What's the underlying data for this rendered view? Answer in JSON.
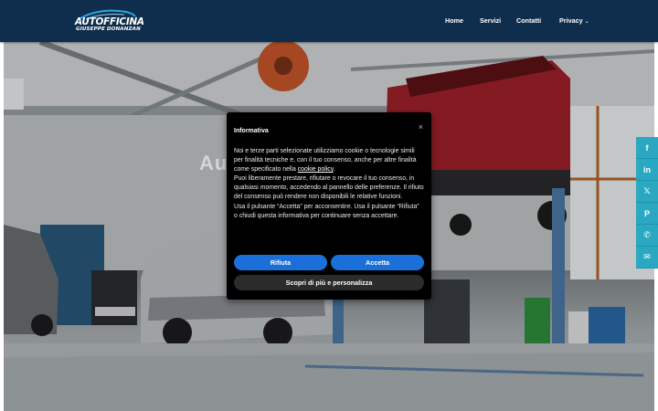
{
  "brand": {
    "name": "AUTOFFICINA",
    "subtitle": "GIUSEPPE DONANZAN"
  },
  "nav": {
    "items": [
      {
        "label": "Home"
      },
      {
        "label": "Servizi"
      },
      {
        "label": "Contatti"
      },
      {
        "label": "Privacy",
        "caret": "⌄"
      }
    ]
  },
  "hero": {
    "title": "Au                        an"
  },
  "cookie": {
    "title": "Informativa",
    "close": "×",
    "para1_a": "Noi e terze parti selezionate utilizziamo cookie o tecnologie simili per finalità tecniche e, con il tuo consenso, anche per altre finalità come specificato nella ",
    "para1_link": "cookie policy",
    "para1_b": ".",
    "para2": "Puoi liberamente prestare, rifiutare o revocare il tuo consenso, in qualsiasi momento, accedendo al pannello delle preferenze. Il rifiuto del consenso può rendere non disponibili le relative funzioni.",
    "para3": "Usa il pulsante “Accetta” per acconsentire. Usa il pulsante “Rifiuta” o chiudi questa informativa per continuare senza accettare.",
    "reject_label": "Rifiuta",
    "accept_label": "Accetta",
    "more_label": "Scopri di più e personalizza"
  },
  "share": {
    "buttons": [
      {
        "icon": "facebook-icon",
        "glyph": "f"
      },
      {
        "icon": "linkedin-icon",
        "glyph": "in"
      },
      {
        "icon": "x-twitter-icon",
        "glyph": "𝕏"
      },
      {
        "icon": "pinterest-icon",
        "glyph": "P"
      },
      {
        "icon": "whatsapp-icon",
        "glyph": "✆"
      },
      {
        "icon": "email-icon",
        "glyph": "✉"
      }
    ]
  },
  "colors": {
    "header": "#0f2e4e",
    "primary_button": "#1a6fd8",
    "share": "#2aa8c2"
  }
}
